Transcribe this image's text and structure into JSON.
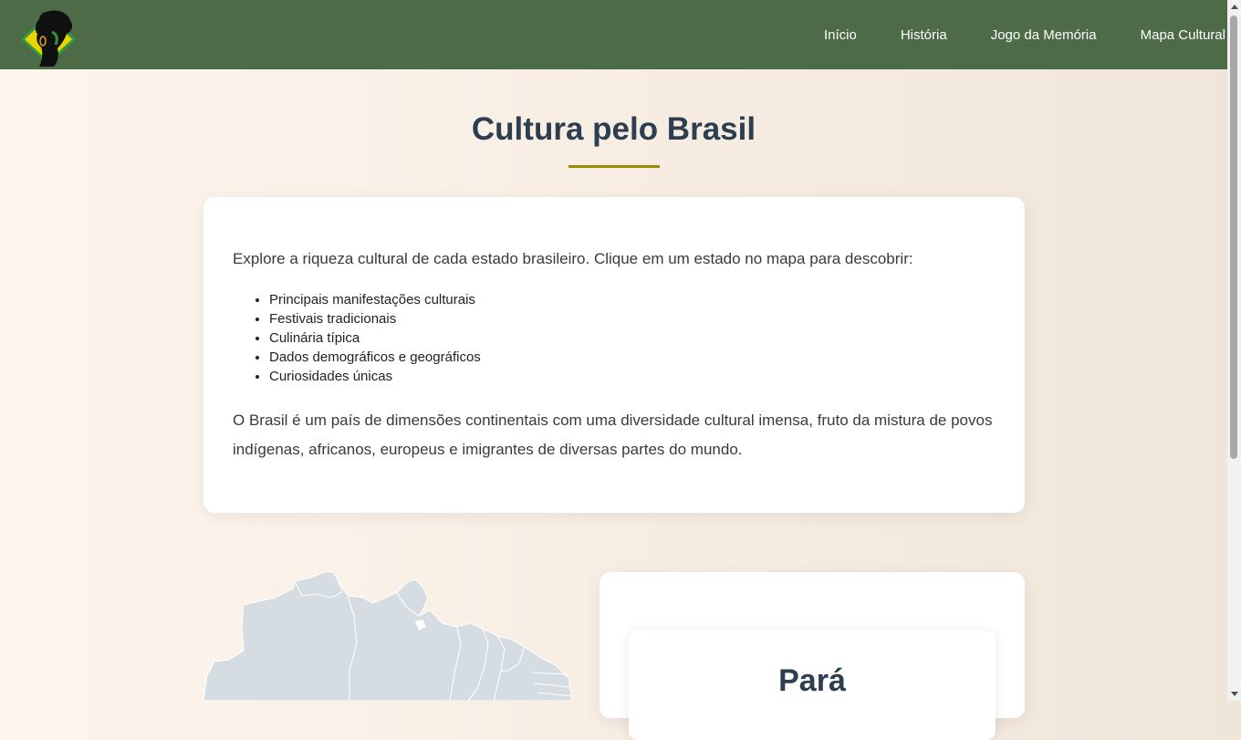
{
  "nav": {
    "logo_alt": "logo",
    "links": [
      "Início",
      "História",
      "Jogo da Memória",
      "Mapa Cultural"
    ]
  },
  "page": {
    "title": "Cultura pelo Brasil"
  },
  "intro": {
    "text": "Explore a riqueza cultural de cada estado brasileiro. Clique em um estado no mapa para descobrir:",
    "features": [
      "Principais manifestações culturais",
      "Festivais tradicionais",
      "Culinária típica",
      "Dados demográficos e geográficos",
      "Curiosidades únicas"
    ],
    "body": "O Brasil é um país de dimensões continentais com uma diversidade cultural imensa, fruto da mistura de povos indígenas, africanos, europeus e imigrantes de diversas partes do mundo."
  },
  "state_panel": {
    "name": "Pará"
  },
  "colors": {
    "nav_bg": "#4d6b47",
    "title_text": "#2c3e50",
    "accent_underline": "#9c8a05",
    "map_fill": "#d5dde2"
  }
}
